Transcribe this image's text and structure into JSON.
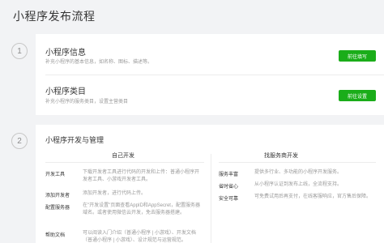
{
  "page_title": "小程序发布流程",
  "steps": [
    {
      "number": "1",
      "rows": [
        {
          "title": "小程序信息",
          "desc": "补充小程序的基本信息，如名称、图标、描述等。",
          "button": "前往填写"
        },
        {
          "title": "小程序类目",
          "desc": "补充小程序的服务类目，设置主营类目",
          "button": "前往设置"
        }
      ]
    },
    {
      "number": "2",
      "title": "小程序开发与管理",
      "self_dev": {
        "heading": "自己开发",
        "items": [
          {
            "label": "开发工具",
            "text": "下载开发者工具进行代码的开发和上传：普通小程序开发者工具、小游戏开发者工具。"
          },
          {
            "label": "添加开发者",
            "text": "添加开发者，进行代码上传。"
          },
          {
            "label": "配置服务器",
            "text": "在\"开发设置\"页面查看AppID和AppSecret，配置服务器域名。或者使用微信云开发，免去服务器搭建。"
          },
          {
            "label": "帮助文档",
            "text": "可以阅读入门介绍（普通小程序 | 小游戏）、开发文档（普通小程序 | 小游戏）、设计规范与运营规范。"
          }
        ]
      },
      "provider_dev": {
        "heading": "找服务商开发",
        "items": [
          {
            "label": "服务丰富",
            "text": "提供多行业、多功能的小程序开发服务。"
          },
          {
            "label": "省时省心",
            "text": "从小程序认证到发布上线，全流程支持。"
          },
          {
            "label": "安全可靠",
            "text": "可免费试用后再支付，在线客服响应，官方售后保障。"
          }
        ]
      }
    }
  ]
}
